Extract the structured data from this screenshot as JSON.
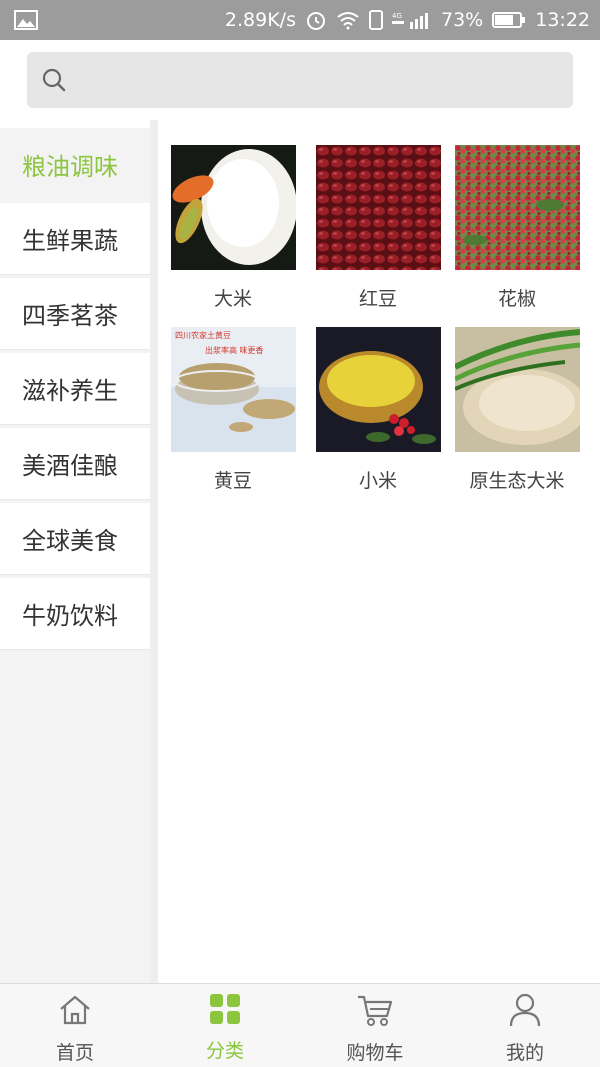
{
  "status_bar": {
    "speed": "2.89K/s",
    "network": "4G",
    "battery": "73%",
    "time": "13:22"
  },
  "search": {
    "placeholder": ""
  },
  "sidebar": {
    "items": [
      {
        "label": "粮油调味",
        "active": true
      },
      {
        "label": "生鲜果蔬"
      },
      {
        "label": "四季茗茶"
      },
      {
        "label": "滋补养生"
      },
      {
        "label": "美酒佳酿"
      },
      {
        "label": "全球美食"
      },
      {
        "label": "牛奶饮料"
      }
    ]
  },
  "products": [
    {
      "name": "大米"
    },
    {
      "name": "红豆"
    },
    {
      "name": "花椒"
    },
    {
      "name": "黄豆",
      "image_text": [
        "四川农家土黄豆",
        "出浆率高 味更香"
      ]
    },
    {
      "name": "小米"
    },
    {
      "name": "原生态大米"
    }
  ],
  "bottom_nav": {
    "items": [
      {
        "label": "首页",
        "icon": "home-icon"
      },
      {
        "label": "分类",
        "icon": "category-grid-icon",
        "active": true
      },
      {
        "label": "购物车",
        "icon": "cart-icon"
      },
      {
        "label": "我的",
        "icon": "user-icon"
      }
    ]
  },
  "colors": {
    "accent": "#8cc63f",
    "status_bar": "#9c9c9c"
  }
}
